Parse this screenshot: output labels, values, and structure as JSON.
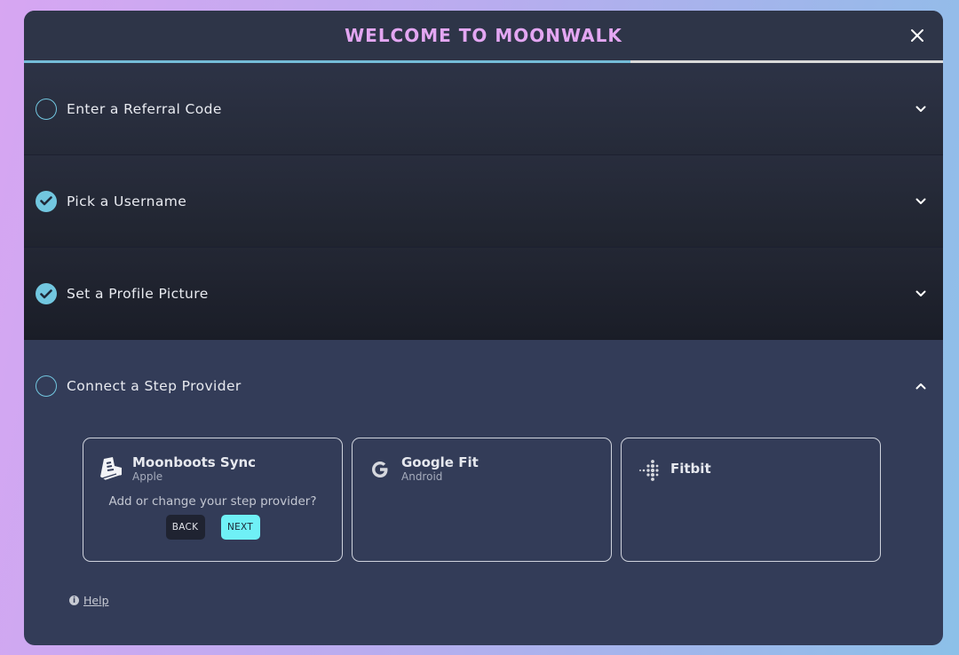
{
  "header": {
    "title": "WELCOME TO MOONWALK",
    "close_icon": "close-icon"
  },
  "progress": {
    "fraction": 0.66,
    "fill_color": "#74bcd8",
    "track_color": "#d9d9d9"
  },
  "steps": [
    {
      "label": "Enter a Referral Code",
      "status": "incomplete",
      "expanded": false
    },
    {
      "label": "Pick a Username",
      "status": "complete",
      "expanded": false
    },
    {
      "label": "Set a Profile Picture",
      "status": "complete",
      "expanded": false
    },
    {
      "label": "Connect a Step Provider",
      "status": "incomplete",
      "expanded": true
    }
  ],
  "providers": [
    {
      "name": "Moonboots Sync",
      "platform": "Apple",
      "icon": "moonboots-icon",
      "prompt": "Add or change your step provider?",
      "back_label": "BACK",
      "next_label": "NEXT"
    },
    {
      "name": "Google Fit",
      "platform": "Android",
      "icon": "google-icon"
    },
    {
      "name": "Fitbit",
      "icon": "fitbit-icon"
    }
  ],
  "help": {
    "label": "Help",
    "icon": "info-icon",
    "icon_glyph": "i"
  },
  "colors": {
    "accent_cyan": "#72c7e0",
    "title_pink": "#e3a6f2",
    "next_button": "#6ff0f6",
    "panel_bg": "#333c58"
  }
}
